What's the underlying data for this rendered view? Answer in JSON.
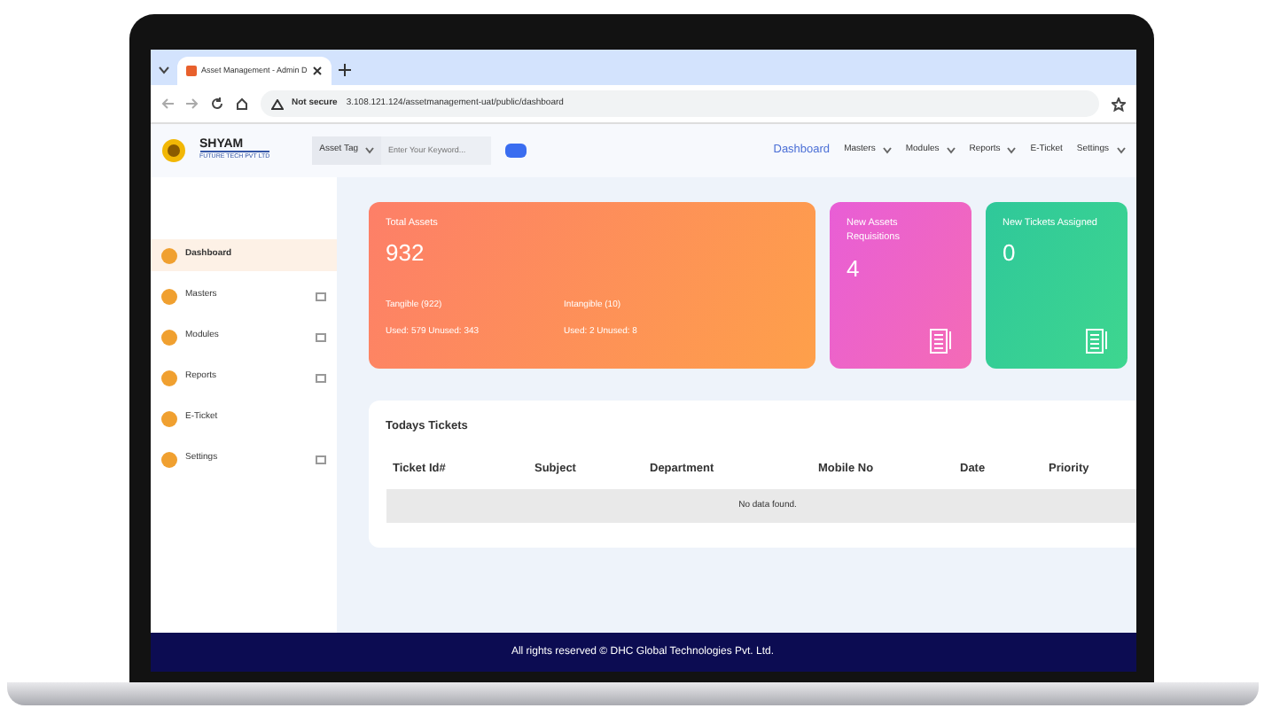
{
  "browser": {
    "tab_title": "Asset Management - Admin D",
    "url_warning": "Not secure",
    "url": "3.108.121.124/assetmanagement-uat/public/dashboard"
  },
  "header": {
    "brand": "SHYAM",
    "tagline": "FUTURE TECH PVT LTD",
    "search_filter": "Asset Tag",
    "search_placeholder": "Enter Your Keyword...",
    "nav": [
      {
        "label": "Dashboard",
        "selected": true,
        "dropdown": false
      },
      {
        "label": "Masters",
        "selected": false,
        "dropdown": true
      },
      {
        "label": "Modules",
        "selected": false,
        "dropdown": true
      },
      {
        "label": "Reports",
        "selected": false,
        "dropdown": true
      },
      {
        "label": "E-Ticket",
        "selected": false,
        "dropdown": false
      },
      {
        "label": "Settings",
        "selected": false,
        "dropdown": true
      }
    ]
  },
  "sidebar": {
    "items": [
      {
        "label": "Dashboard",
        "selected": true,
        "expandable": false
      },
      {
        "label": "Masters",
        "selected": false,
        "expandable": true
      },
      {
        "label": "Modules",
        "selected": false,
        "expandable": true
      },
      {
        "label": "Reports",
        "selected": false,
        "expandable": true
      },
      {
        "label": "E-Ticket",
        "selected": false,
        "expandable": false
      },
      {
        "label": "Settings",
        "selected": false,
        "expandable": true
      }
    ]
  },
  "stats": [
    {
      "kind": "total",
      "title": "Total Assets",
      "value": "932",
      "details": [
        [
          "Tangible (922)",
          "Used: 579  Unused: 343"
        ],
        [
          "Intangible (10)",
          "Used: 2  Unused: 8"
        ]
      ]
    },
    {
      "kind": "requisitions",
      "title": "New Assets Requisitions",
      "value": "4"
    },
    {
      "kind": "tickets",
      "title": "New Tickets Assigned",
      "value": "0"
    }
  ],
  "tickets": {
    "title": "Todays Tickets",
    "columns": [
      "Ticket Id#",
      "Subject",
      "Department",
      "Mobile No",
      "Date",
      "Priority"
    ],
    "empty_message": "No data found."
  },
  "footer": "All rights reserved © DHC Global Technologies Pvt. Ltd."
}
